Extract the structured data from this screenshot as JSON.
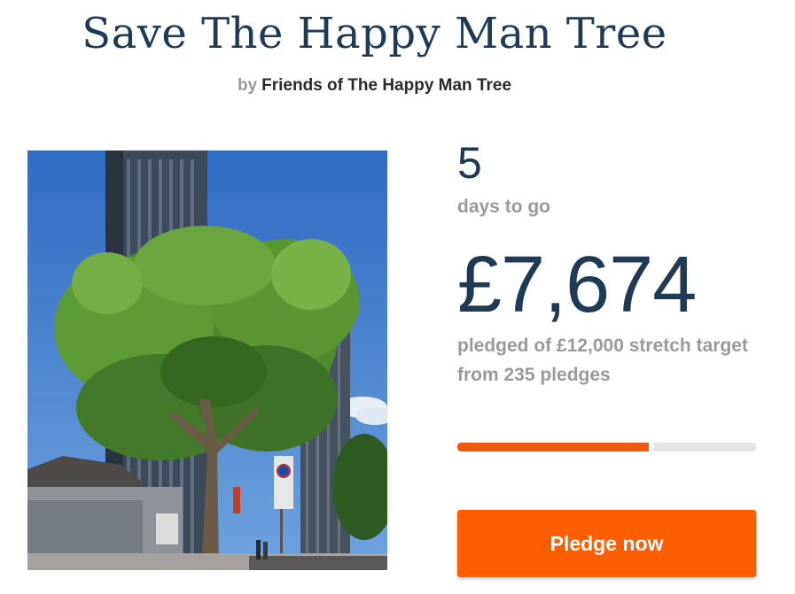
{
  "project": {
    "title": "Save The Happy Man Tree",
    "by_label": "by",
    "creator": "Friends of The Happy Man Tree"
  },
  "stats": {
    "days_remaining": "5",
    "days_label": "days to go",
    "amount_pledged": "£7,674",
    "pledged_line_1": "pledged of £12,000 stretch target",
    "pledged_line_2": "from 235 pledges",
    "progress_fraction": 0.64
  },
  "actions": {
    "pledge_label": "Pledge now"
  },
  "colors": {
    "heading": "#1f3a52",
    "muted": "#9a9a9a",
    "accent": "#ff5e00",
    "progress_fill": "#f05a0c",
    "progress_track": "#e6e6e6"
  },
  "icons": {
    "project_image": "tree-photo"
  }
}
